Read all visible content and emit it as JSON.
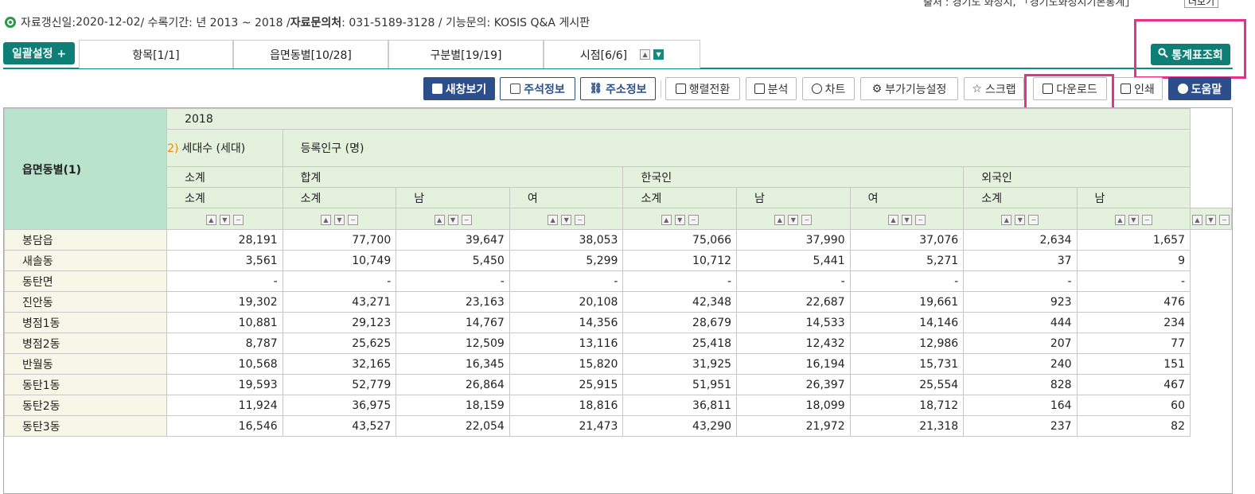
{
  "source": {
    "text": "출처 : 경기도 화성시, 「경기도화성시기본통계」",
    "more_label": "더보기"
  },
  "info": {
    "update_label": "자료갱신일: ",
    "update_date": "2020-12-02",
    "period_label": " / 수록기간: 년 2013 ~ 2018 / ",
    "contact_label": "자료문의처",
    "contact_value": " : 031-5189-3128 / 기능문의: KOSIS Q&A 게시판"
  },
  "bulk_button": "일괄설정 +",
  "tabs": [
    {
      "label": "항목[1/1]"
    },
    {
      "label": "읍면동별[10/28]"
    },
    {
      "label": "구분별[19/19]"
    },
    {
      "label": "시점[6/6]"
    }
  ],
  "stat_button": "통계표조회",
  "toolbar": {
    "new_window": "새창보기",
    "annotation": "주석정보",
    "address": "주소정보",
    "transpose": "행렬전환",
    "analysis": "분석",
    "chart": "차트",
    "addon": "부가기능설정",
    "scrap": "스크랩",
    "download": "다운로드",
    "print": "인쇄",
    "help": "도움말"
  },
  "table": {
    "corner_label": "읍면동별(1)",
    "year": "2018",
    "footnote_marker": "2)",
    "households": "세대수 (세대)",
    "population": "등록인구 (명)",
    "subtotal": "소계",
    "total": "합계",
    "korean": "한국인",
    "foreign": "외국인",
    "male": "남",
    "female": "여",
    "rows": [
      {
        "name": "봉담읍",
        "cells": [
          "28,191",
          "77,700",
          "39,647",
          "38,053",
          "75,066",
          "37,990",
          "37,076",
          "2,634",
          "1,657"
        ]
      },
      {
        "name": "새솔동",
        "cells": [
          "3,561",
          "10,749",
          "5,450",
          "5,299",
          "10,712",
          "5,441",
          "5,271",
          "37",
          "9"
        ]
      },
      {
        "name": "동탄면",
        "cells": [
          "-",
          "-",
          "-",
          "-",
          "-",
          "-",
          "-",
          "-",
          "-"
        ]
      },
      {
        "name": "진안동",
        "cells": [
          "19,302",
          "43,271",
          "23,163",
          "20,108",
          "42,348",
          "22,687",
          "19,661",
          "923",
          "476"
        ]
      },
      {
        "name": "병점1동",
        "cells": [
          "10,881",
          "29,123",
          "14,767",
          "14,356",
          "28,679",
          "14,533",
          "14,146",
          "444",
          "234"
        ]
      },
      {
        "name": "병점2동",
        "cells": [
          "8,787",
          "25,625",
          "12,509",
          "13,116",
          "25,418",
          "12,432",
          "12,986",
          "207",
          "77"
        ]
      },
      {
        "name": "반월동",
        "cells": [
          "10,568",
          "32,165",
          "16,345",
          "15,820",
          "31,925",
          "16,194",
          "15,731",
          "240",
          "151"
        ]
      },
      {
        "name": "동탄1동",
        "cells": [
          "19,593",
          "52,779",
          "26,864",
          "25,915",
          "51,951",
          "26,397",
          "25,554",
          "828",
          "467"
        ]
      },
      {
        "name": "동탄2동",
        "cells": [
          "11,924",
          "36,975",
          "18,159",
          "18,816",
          "36,811",
          "18,099",
          "18,712",
          "164",
          "60"
        ]
      },
      {
        "name": "동탄3동",
        "cells": [
          "16,546",
          "43,527",
          "22,054",
          "21,473",
          "43,290",
          "21,972",
          "21,318",
          "237",
          "82"
        ]
      }
    ]
  },
  "colors": {
    "accent": "#0e7f77",
    "navy": "#2c4f8c",
    "highlight": "#e8328a",
    "header_bg": "#e3f1dd",
    "corner_bg": "#b9e3cc",
    "row_header_bg": "#f7f7e8"
  }
}
